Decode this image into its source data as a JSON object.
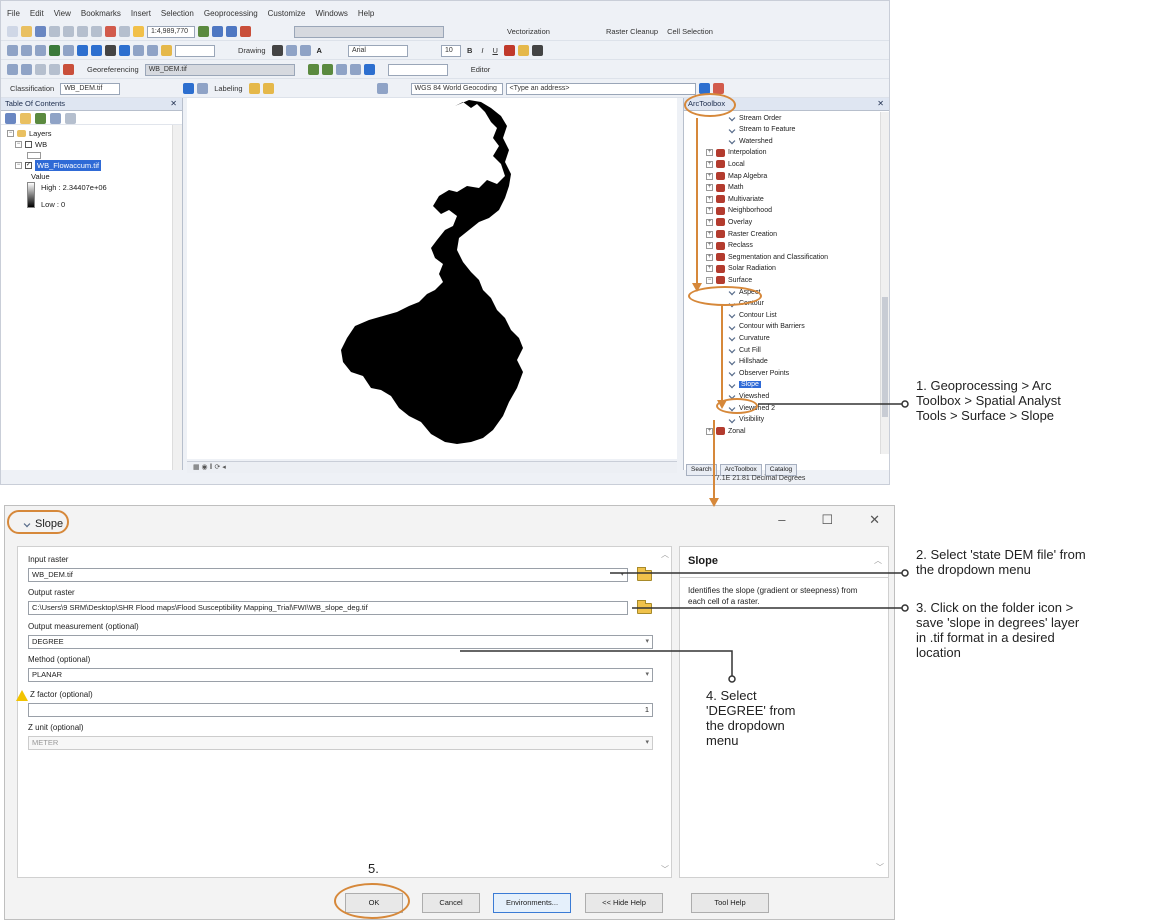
{
  "menu": [
    "File",
    "Edit",
    "View",
    "Bookmarks",
    "Insert",
    "Selection",
    "Geoprocessing",
    "Customize",
    "Windows",
    "Help"
  ],
  "toolbars": {
    "scale": "1:4,989,770",
    "vectorization": "Vectorization",
    "raster_cleanup": "Raster Cleanup",
    "cell_selection": "Cell Selection",
    "drawing": "Drawing",
    "font": "Arial",
    "font_size": "10",
    "georeferencing": "Georeferencing",
    "georef_layer": "WB_DEM.tif",
    "editor": "Editor",
    "classification": "Classification",
    "classification_layer": "WB_DEM.tif",
    "labeling": "Labeling",
    "basemap": "WGS 84 World Geocoding",
    "address_placeholder": "<Type an address>"
  },
  "toc": {
    "title": "Table Of Contents",
    "layers_label": "Layers",
    "wb_label": "WB",
    "selected_layer": "WB_Flowaccum.tif",
    "value_label": "Value",
    "high_label": "High : 2.34407e+06",
    "low_label": "Low : 0"
  },
  "toolbox": {
    "title": "ArcToolbox",
    "items": [
      {
        "label": "Stream Order",
        "kind": "tool"
      },
      {
        "label": "Stream to Feature",
        "kind": "tool"
      },
      {
        "label": "Watershed",
        "kind": "tool"
      },
      {
        "label": "Interpolation",
        "kind": "set"
      },
      {
        "label": "Local",
        "kind": "set"
      },
      {
        "label": "Map Algebra",
        "kind": "set"
      },
      {
        "label": "Math",
        "kind": "set"
      },
      {
        "label": "Multivariate",
        "kind": "set"
      },
      {
        "label": "Neighborhood",
        "kind": "set"
      },
      {
        "label": "Overlay",
        "kind": "set"
      },
      {
        "label": "Raster Creation",
        "kind": "set"
      },
      {
        "label": "Reclass",
        "kind": "set"
      },
      {
        "label": "Segmentation and Classification",
        "kind": "set"
      },
      {
        "label": "Solar Radiation",
        "kind": "set"
      },
      {
        "label": "Surface",
        "kind": "set-open"
      },
      {
        "label": "Aspect",
        "kind": "tool"
      },
      {
        "label": "Contour",
        "kind": "tool"
      },
      {
        "label": "Contour List",
        "kind": "tool"
      },
      {
        "label": "Contour with Barriers",
        "kind": "tool"
      },
      {
        "label": "Curvature",
        "kind": "tool"
      },
      {
        "label": "Cut Fill",
        "kind": "tool"
      },
      {
        "label": "Hillshade",
        "kind": "tool"
      },
      {
        "label": "Observer Points",
        "kind": "tool"
      },
      {
        "label": "Slope",
        "kind": "tool-selected"
      },
      {
        "label": "Viewshed",
        "kind": "tool"
      },
      {
        "label": "Viewshed 2",
        "kind": "tool"
      },
      {
        "label": "Visibility",
        "kind": "tool"
      },
      {
        "label": "Zonal",
        "kind": "set"
      }
    ],
    "tabs": [
      "Search",
      "ArcToolbox",
      "Catalog"
    ],
    "coords": "77.1E  21.81 Decimal Degrees"
  },
  "dialog": {
    "title": "Slope",
    "input_raster_label": "Input raster",
    "input_raster_value": "WB_DEM.tif",
    "output_raster_label": "Output raster",
    "output_raster_value": "C:\\Users\\9 SRM\\Desktop\\SHR Flood maps\\Flood Susceptibility Mapping_Trial\\FWI\\WB_slope_deg.tif",
    "measurement_label": "Output measurement (optional)",
    "measurement_value": "DEGREE",
    "method_label": "Method (optional)",
    "method_value": "PLANAR",
    "zfactor_label": "Z factor (optional)",
    "zfactor_value": "1",
    "zunit_label": "Z unit (optional)",
    "zunit_value": "METER",
    "help_title": "Slope",
    "help_text": "Identifies the slope (gradient or steepness) from each cell of a raster.",
    "buttons": {
      "ok": "OK",
      "cancel": "Cancel",
      "environments": "Environments...",
      "hide_help": "<< Hide Help",
      "tool_help": "Tool Help"
    }
  },
  "annotations": {
    "a1": [
      "1. Geoprocessing > Arc",
      "Toolbox > Spatial Analyst",
      "Tools > Surface > Slope"
    ],
    "a2": [
      "2. Select 'state DEM file' from",
      "the dropdown menu"
    ],
    "a3": [
      "3. Click on the folder icon >",
      "save 'slope in degrees' layer",
      "in .tif format in a desired",
      "location"
    ],
    "a4": [
      "4. Select",
      "'DEGREE' from",
      "the dropdown",
      "menu"
    ],
    "a5": "5."
  },
  "colors": {
    "annotation": "#d6883a",
    "selection": "#2f6ad6",
    "map_fill": "#000000"
  }
}
